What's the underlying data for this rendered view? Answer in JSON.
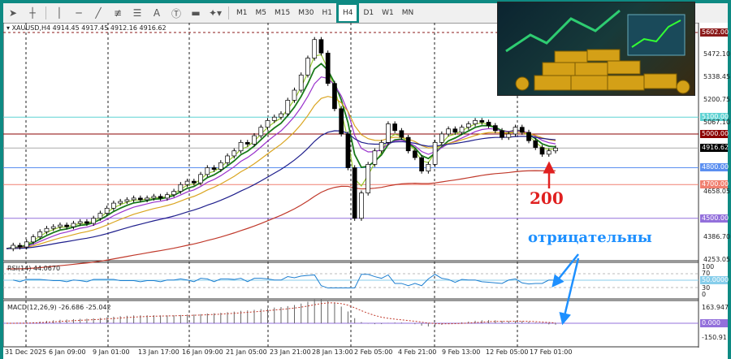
{
  "toolbar": {
    "tools": [
      "cursor-icon",
      "crosshair-icon",
      "vertical-line-icon",
      "horizontal-line-icon",
      "trendline-icon",
      "fibonacci-icon",
      "channel-icon",
      "text-icon",
      "text-label-icon",
      "rectangle-icon",
      "shapes-icon"
    ],
    "text_tool": "A",
    "timeframes": [
      "M1",
      "M5",
      "M15",
      "M30",
      "H1",
      "H4",
      "D1",
      "W1",
      "MN"
    ],
    "active_timeframe": "H4"
  },
  "chart": {
    "symbol_info": "XAUUSD,H4  4914.45 4917.45 4912.16 4916.62",
    "price_axis": [
      "5472.10",
      "5338.45",
      "5200.75",
      "5067.10",
      "4658.05",
      "4386.70",
      "4253.05"
    ],
    "price_levels": [
      {
        "value": "5602.00",
        "color": "#8b1a1a"
      },
      {
        "value": "5100.00",
        "color": "#5fd3d3"
      },
      {
        "value": "5000.00",
        "color": "#8b0000"
      },
      {
        "value": "4916.62",
        "color": "#000000"
      },
      {
        "value": "4800.00",
        "color": "#5b8ff0"
      },
      {
        "value": "4700.00",
        "color": "#f08070"
      },
      {
        "value": "4500.00",
        "color": "#9370db"
      }
    ],
    "closes": [
      4320,
      4340,
      4330,
      4360,
      4390,
      4420,
      4440,
      4450,
      4460,
      4450,
      4470,
      4480,
      4470,
      4500,
      4530,
      4560,
      4590,
      4600,
      4610,
      4620,
      4610,
      4620,
      4630,
      4620,
      4640,
      4660,
      4700,
      4720,
      4710,
      4760,
      4800,
      4790,
      4830,
      4870,
      4900,
      4950,
      4940,
      4990,
      5040,
      5080,
      5100,
      5120,
      5200,
      5260,
      5350,
      5450,
      5560,
      5480,
      5300,
      5150,
      5000,
      4800,
      4500,
      4650,
      4820,
      4900,
      4950,
      5060,
      5020,
      4980,
      4900,
      4860,
      4780,
      4820,
      4950,
      5000,
      5030,
      5010,
      5040,
      5060,
      5080,
      5070,
      5050,
      5020,
      4980,
      5000,
      5040,
      5010,
      4960,
      4920,
      4880,
      4900,
      4916.62
    ],
    "annotation_200": "200",
    "annotation_negative": "отрицательны"
  },
  "rsi": {
    "label": "RSI(14) 44.0670",
    "axis": [
      "100",
      "70",
      "30",
      "0"
    ],
    "level": "50.0000"
  },
  "macd": {
    "label": "MACD(12,26,9) -26.686 -25.042",
    "axis": [
      "163.947",
      "-150.91"
    ],
    "level": "0.000"
  },
  "time_axis": [
    "31 Dec 2025",
    "6 Jan 09:00",
    "9 Jan 01:00",
    "13 Jan 17:00",
    "16 Jan 09:00",
    "21 Jan 05:00",
    "23 Jan 21:00",
    "28 Jan 13:00",
    "2 Feb 05:00",
    "4 Feb 21:00",
    "9 Feb 13:00",
    "12 Feb 05:00",
    "17 Feb 01:00"
  ]
}
